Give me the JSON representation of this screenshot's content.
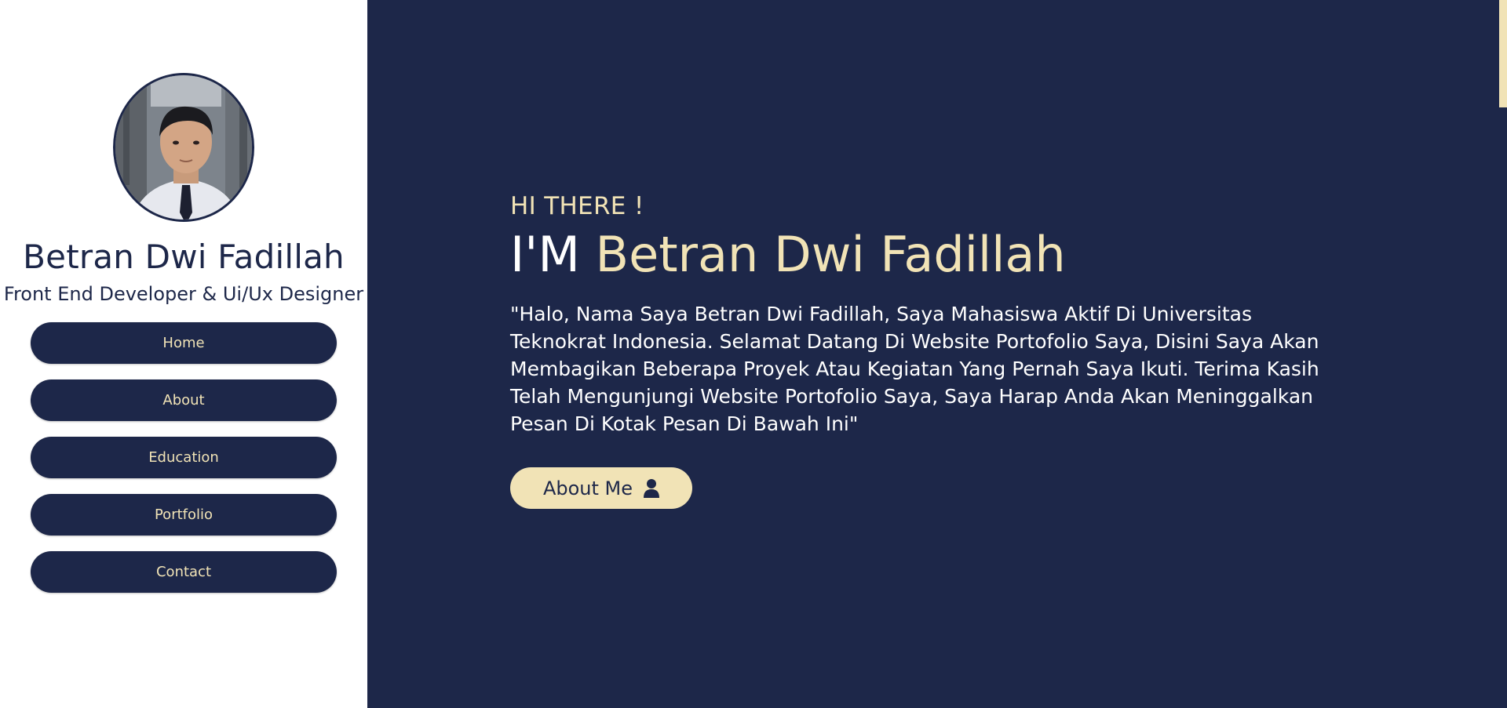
{
  "sidebar": {
    "avatar_alt": "profile photo",
    "name": "Betran Dwi Fadillah",
    "role": "Front End Developer & Ui/Ux Designer",
    "nav": [
      {
        "label": "Home"
      },
      {
        "label": "About"
      },
      {
        "label": "Education"
      },
      {
        "label": "Portfolio"
      },
      {
        "label": "Contact"
      }
    ]
  },
  "hero": {
    "greeting": "HI THERE !",
    "headline_prefix": "I'M ",
    "headline_name": "Betran Dwi Fadillah",
    "intro": "\"Halo, Nama Saya Betran Dwi Fadillah, Saya Mahasiswa Aktif Di Universitas Teknokrat Indonesia. Selamat Datang Di Website Portofolio Saya, Disini Saya Akan Membagikan Beberapa Proyek Atau Kegiatan Yang Pernah Saya Ikuti. Terima Kasih Telah Mengunjungi Website Portofolio Saya, Saya Harap Anda Akan Meninggalkan Pesan Di Kotak Pesan Di Bawah Ini\"",
    "about_button_label": "About Me",
    "about_button_icon": "user-icon"
  },
  "colors": {
    "navy": "#1d2749",
    "cream": "#f1e3b6",
    "white": "#ffffff"
  }
}
